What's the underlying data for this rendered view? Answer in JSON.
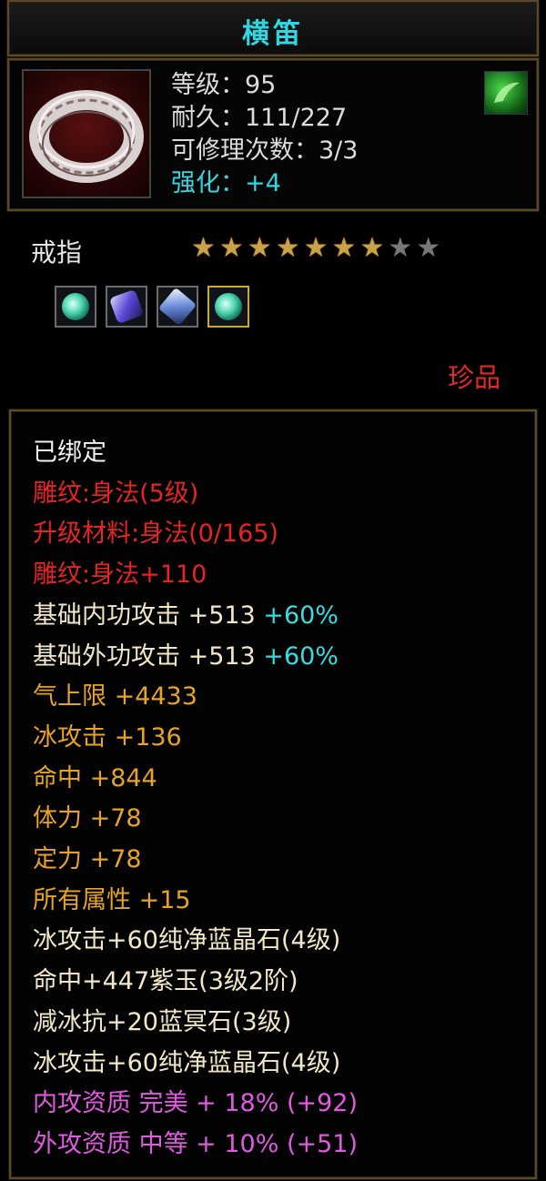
{
  "item": {
    "name": "横笛",
    "level_line": "等级：95",
    "durability_line": "耐久：111/227",
    "repair_line": "可修理次数：3/3",
    "enhance_line": "强化：+4",
    "type": "戒指",
    "rarity": "珍品",
    "stars": {
      "filled": 7,
      "total": 9
    },
    "icon": "silver-ring-icon",
    "skill_icon": "green-leaf-skill-icon",
    "gems": [
      {
        "icon": "pure-blue-crystal-icon",
        "selected": false
      },
      {
        "icon": "purple-jade-icon",
        "selected": false
      },
      {
        "icon": "blue-nether-stone-icon",
        "selected": false
      },
      {
        "icon": "pure-blue-crystal-icon",
        "selected": true
      }
    ]
  },
  "attributes": [
    {
      "text": "已绑定",
      "color": "white"
    },
    {
      "text": "雕纹:身法(5级)",
      "color": "red"
    },
    {
      "text": "升级材料:身法(0/165)",
      "color": "red"
    },
    {
      "text": "雕纹:身法+110",
      "color": "red"
    },
    {
      "text": "基础内功攻击 +513",
      "extra": " +60%",
      "color": "light"
    },
    {
      "text": "基础外功攻击 +513",
      "extra": " +60%",
      "color": "light"
    },
    {
      "text": "气上限 +4433",
      "color": "orange"
    },
    {
      "text": "冰攻击 +136",
      "color": "orange"
    },
    {
      "text": "命中 +844",
      "color": "orange"
    },
    {
      "text": "体力 +78",
      "color": "orange"
    },
    {
      "text": "定力 +78",
      "color": "orange"
    },
    {
      "text": "所有属性 +15",
      "color": "orange"
    },
    {
      "text": "冰攻击+60纯净蓝晶石(4级)",
      "color": "light"
    },
    {
      "text": "命中+447紫玉(3级2阶)",
      "color": "light"
    },
    {
      "text": "减冰抗+20蓝冥石(3级)",
      "color": "light"
    },
    {
      "text": "冰攻击+60纯净蓝晶石(4级)",
      "color": "light"
    },
    {
      "text": "内攻资质 完美 + 18% (+92)",
      "color": "pink"
    },
    {
      "text": "外攻资质 中等 + 10% (+51)",
      "color": "pink"
    }
  ],
  "colors": {
    "title": "#2fd6df",
    "enhance": "#33d7e0",
    "rarity": "#e02a2a",
    "red": "#e52424",
    "orange": "#e6a326",
    "pink": "#e05ae0",
    "cyan": "#36dce0"
  }
}
